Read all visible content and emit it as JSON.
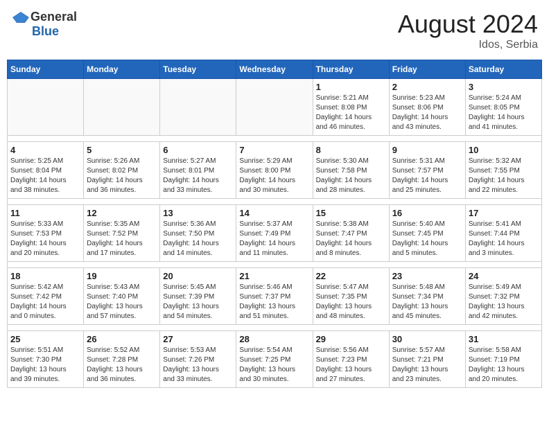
{
  "header": {
    "logo_general": "General",
    "logo_blue": "Blue",
    "month_year": "August 2024",
    "location": "Idos, Serbia"
  },
  "weekdays": [
    "Sunday",
    "Monday",
    "Tuesday",
    "Wednesday",
    "Thursday",
    "Friday",
    "Saturday"
  ],
  "weeks": [
    [
      {
        "day": "",
        "info": ""
      },
      {
        "day": "",
        "info": ""
      },
      {
        "day": "",
        "info": ""
      },
      {
        "day": "",
        "info": ""
      },
      {
        "day": "1",
        "info": "Sunrise: 5:21 AM\nSunset: 8:08 PM\nDaylight: 14 hours\nand 46 minutes."
      },
      {
        "day": "2",
        "info": "Sunrise: 5:23 AM\nSunset: 8:06 PM\nDaylight: 14 hours\nand 43 minutes."
      },
      {
        "day": "3",
        "info": "Sunrise: 5:24 AM\nSunset: 8:05 PM\nDaylight: 14 hours\nand 41 minutes."
      }
    ],
    [
      {
        "day": "4",
        "info": "Sunrise: 5:25 AM\nSunset: 8:04 PM\nDaylight: 14 hours\nand 38 minutes."
      },
      {
        "day": "5",
        "info": "Sunrise: 5:26 AM\nSunset: 8:02 PM\nDaylight: 14 hours\nand 36 minutes."
      },
      {
        "day": "6",
        "info": "Sunrise: 5:27 AM\nSunset: 8:01 PM\nDaylight: 14 hours\nand 33 minutes."
      },
      {
        "day": "7",
        "info": "Sunrise: 5:29 AM\nSunset: 8:00 PM\nDaylight: 14 hours\nand 30 minutes."
      },
      {
        "day": "8",
        "info": "Sunrise: 5:30 AM\nSunset: 7:58 PM\nDaylight: 14 hours\nand 28 minutes."
      },
      {
        "day": "9",
        "info": "Sunrise: 5:31 AM\nSunset: 7:57 PM\nDaylight: 14 hours\nand 25 minutes."
      },
      {
        "day": "10",
        "info": "Sunrise: 5:32 AM\nSunset: 7:55 PM\nDaylight: 14 hours\nand 22 minutes."
      }
    ],
    [
      {
        "day": "11",
        "info": "Sunrise: 5:33 AM\nSunset: 7:53 PM\nDaylight: 14 hours\nand 20 minutes."
      },
      {
        "day": "12",
        "info": "Sunrise: 5:35 AM\nSunset: 7:52 PM\nDaylight: 14 hours\nand 17 minutes."
      },
      {
        "day": "13",
        "info": "Sunrise: 5:36 AM\nSunset: 7:50 PM\nDaylight: 14 hours\nand 14 minutes."
      },
      {
        "day": "14",
        "info": "Sunrise: 5:37 AM\nSunset: 7:49 PM\nDaylight: 14 hours\nand 11 minutes."
      },
      {
        "day": "15",
        "info": "Sunrise: 5:38 AM\nSunset: 7:47 PM\nDaylight: 14 hours\nand 8 minutes."
      },
      {
        "day": "16",
        "info": "Sunrise: 5:40 AM\nSunset: 7:45 PM\nDaylight: 14 hours\nand 5 minutes."
      },
      {
        "day": "17",
        "info": "Sunrise: 5:41 AM\nSunset: 7:44 PM\nDaylight: 14 hours\nand 3 minutes."
      }
    ],
    [
      {
        "day": "18",
        "info": "Sunrise: 5:42 AM\nSunset: 7:42 PM\nDaylight: 14 hours\nand 0 minutes."
      },
      {
        "day": "19",
        "info": "Sunrise: 5:43 AM\nSunset: 7:40 PM\nDaylight: 13 hours\nand 57 minutes."
      },
      {
        "day": "20",
        "info": "Sunrise: 5:45 AM\nSunset: 7:39 PM\nDaylight: 13 hours\nand 54 minutes."
      },
      {
        "day": "21",
        "info": "Sunrise: 5:46 AM\nSunset: 7:37 PM\nDaylight: 13 hours\nand 51 minutes."
      },
      {
        "day": "22",
        "info": "Sunrise: 5:47 AM\nSunset: 7:35 PM\nDaylight: 13 hours\nand 48 minutes."
      },
      {
        "day": "23",
        "info": "Sunrise: 5:48 AM\nSunset: 7:34 PM\nDaylight: 13 hours\nand 45 minutes."
      },
      {
        "day": "24",
        "info": "Sunrise: 5:49 AM\nSunset: 7:32 PM\nDaylight: 13 hours\nand 42 minutes."
      }
    ],
    [
      {
        "day": "25",
        "info": "Sunrise: 5:51 AM\nSunset: 7:30 PM\nDaylight: 13 hours\nand 39 minutes."
      },
      {
        "day": "26",
        "info": "Sunrise: 5:52 AM\nSunset: 7:28 PM\nDaylight: 13 hours\nand 36 minutes."
      },
      {
        "day": "27",
        "info": "Sunrise: 5:53 AM\nSunset: 7:26 PM\nDaylight: 13 hours\nand 33 minutes."
      },
      {
        "day": "28",
        "info": "Sunrise: 5:54 AM\nSunset: 7:25 PM\nDaylight: 13 hours\nand 30 minutes."
      },
      {
        "day": "29",
        "info": "Sunrise: 5:56 AM\nSunset: 7:23 PM\nDaylight: 13 hours\nand 27 minutes."
      },
      {
        "day": "30",
        "info": "Sunrise: 5:57 AM\nSunset: 7:21 PM\nDaylight: 13 hours\nand 23 minutes."
      },
      {
        "day": "31",
        "info": "Sunrise: 5:58 AM\nSunset: 7:19 PM\nDaylight: 13 hours\nand 20 minutes."
      }
    ]
  ]
}
